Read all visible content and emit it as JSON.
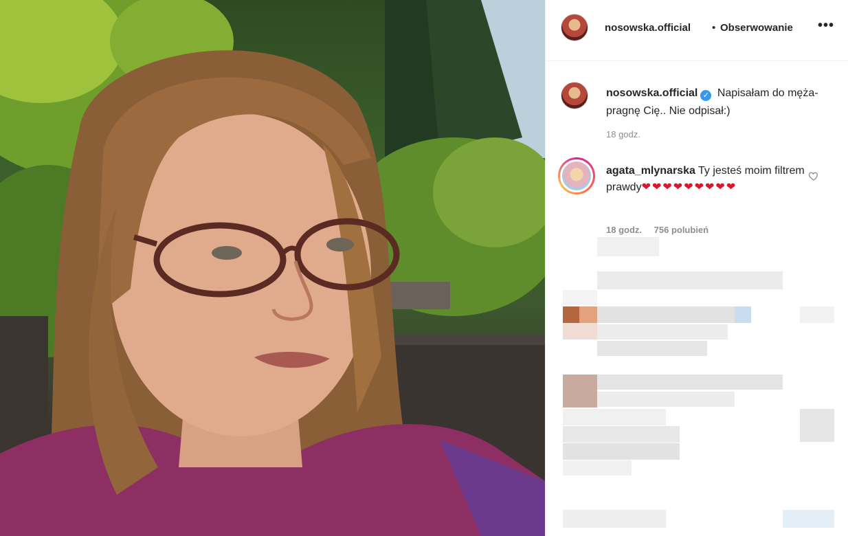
{
  "post": {
    "username": "nosowska.official",
    "separator": "•",
    "follow_label": "Obserwowanie",
    "more_label": "•••",
    "caption": {
      "username": "nosowska.official",
      "verified_mark": "✓",
      "text": "Napisałam do męża- pragnę Cię.. Nie odpisał:)",
      "time": "18 godz."
    },
    "comment": {
      "username": "agata_mlynarska",
      "text": "Ty jesteś moim filtrem prawdy",
      "hearts": "❤❤❤❤❤❤❤❤❤",
      "time": "18 godz.",
      "likes": "756 polubień"
    }
  },
  "icons": {
    "more": "more-options-icon",
    "like": "heart-outline-icon",
    "verified": "verified-badge-icon"
  },
  "colors": {
    "verified": "#3897f0",
    "heart": "#e0132c",
    "muted": "#8e8e8e",
    "text": "#262626"
  }
}
